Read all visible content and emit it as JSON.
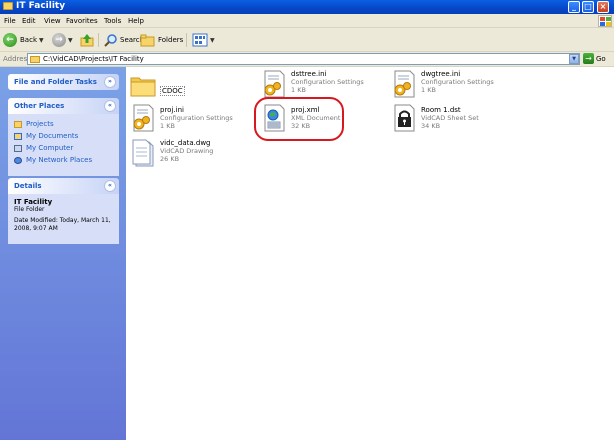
{
  "window": {
    "title": "IT Facility"
  },
  "menu": [
    "File",
    "Edit",
    "View",
    "Favorites",
    "Tools",
    "Help"
  ],
  "toolbar": {
    "back_label": "Back",
    "search_label": "Search",
    "folders_label": "Folders"
  },
  "address": {
    "label": "Address",
    "path": "C:\\VidCAD\\Projects\\IT Facility",
    "go_label": "Go"
  },
  "sidebar": {
    "tasks_title": "File and Folder Tasks",
    "places_title": "Other Places",
    "places": [
      "Projects",
      "My Documents",
      "My Computer",
      "My Network Places"
    ],
    "details_title": "Details",
    "details": {
      "name": "IT Facility",
      "type": "File Folder",
      "modified": "Date Modified: Today, March 11, 2008, 9:07 AM"
    }
  },
  "files": [
    {
      "name": "CDOC",
      "type": "",
      "size": "",
      "icon": "folder-icon"
    },
    {
      "name": "dsttree.ini",
      "type": "Configuration Settings",
      "size": "1 KB",
      "icon": "config-settings-icon"
    },
    {
      "name": "dwgtree.ini",
      "type": "Configuration Settings",
      "size": "1 KB",
      "icon": "config-settings-icon"
    },
    {
      "name": "proj.ini",
      "type": "Configuration Settings",
      "size": "1 KB",
      "icon": "config-settings-icon"
    },
    {
      "name": "proj.xml",
      "type": "XML Document",
      "size": "32 KB",
      "icon": "xml-document-icon"
    },
    {
      "name": "Room 1.dst",
      "type": "VidCAD Sheet Set",
      "size": "34 KB",
      "icon": "lock-file-icon"
    },
    {
      "name": "vidc_data.dwg",
      "type": "VidCAD Drawing",
      "size": "26 KB",
      "icon": "drawing-file-icon"
    }
  ],
  "colors": {
    "title_bar": "#0a5fe4",
    "task_pane": "#6375d6",
    "highlight_circle": "#d8181e",
    "link_blue": "#215dc6"
  }
}
